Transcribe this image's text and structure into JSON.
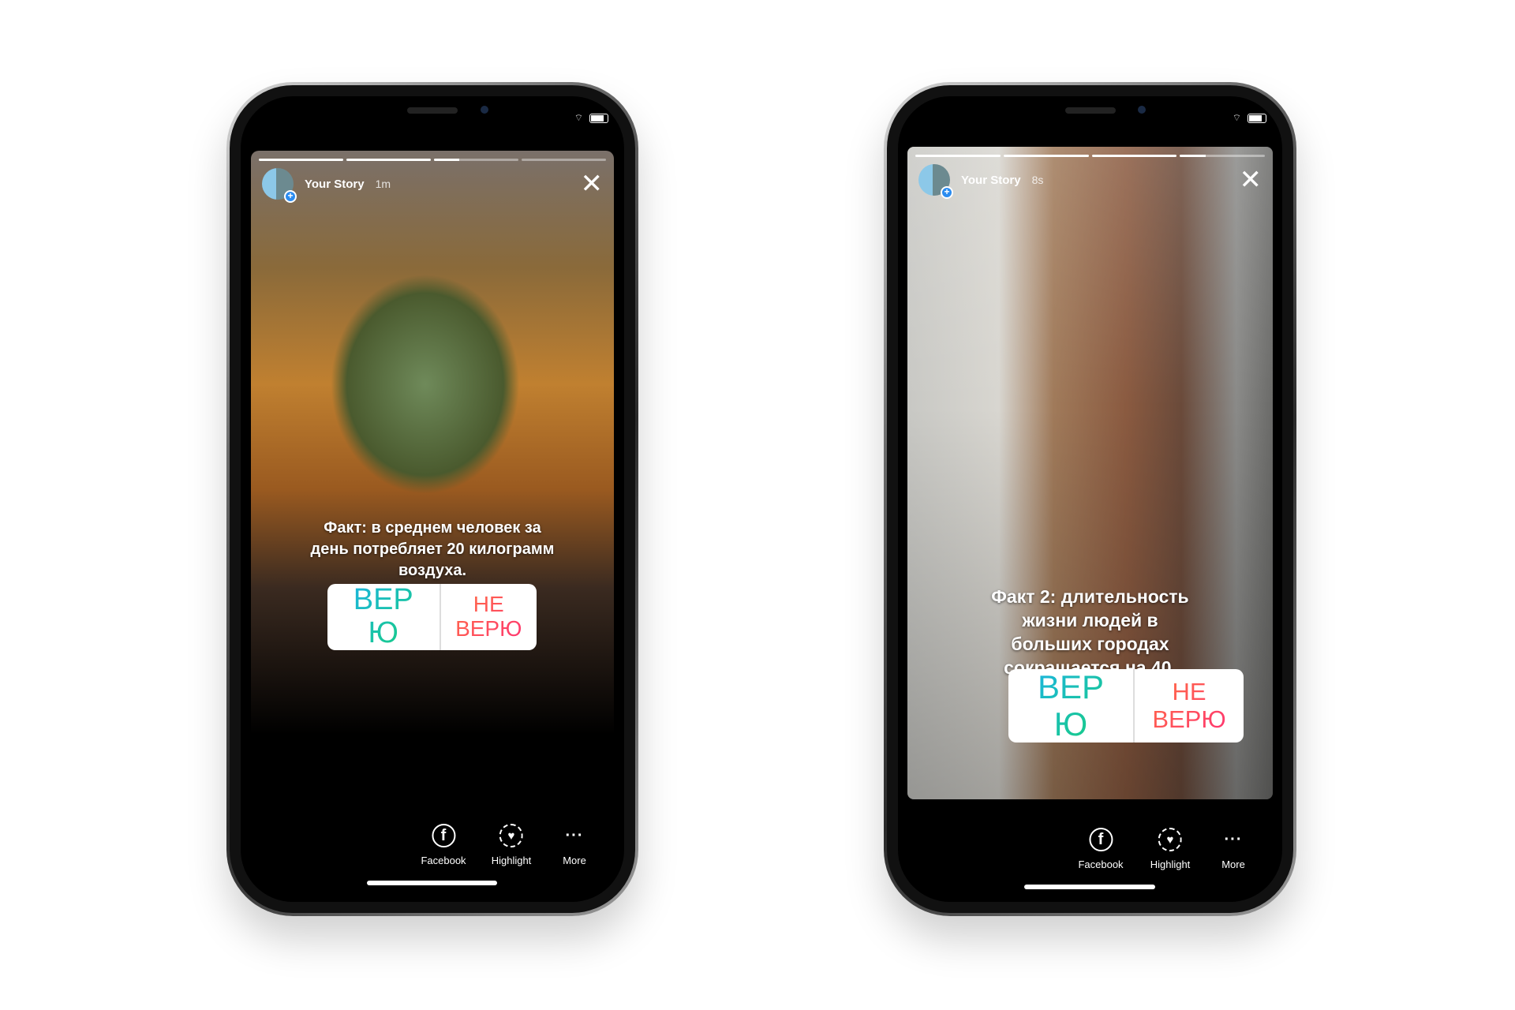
{
  "phones": [
    {
      "story": {
        "title": "Your Story",
        "time": "1m",
        "progress": [
          1,
          1,
          0.3,
          0
        ],
        "caption": "Факт: в среднем человек за день потребляет 20 килограмм воздуха.",
        "poll": {
          "yes": "ВЕР Ю",
          "no": "НЕ ВЕРЮ"
        }
      },
      "actions": [
        {
          "label": "Facebook",
          "icon": "facebook-icon"
        },
        {
          "label": "Highlight",
          "icon": "highlight-heart-icon"
        },
        {
          "label": "More",
          "icon": "more-dots-icon"
        }
      ]
    },
    {
      "story": {
        "title": "Your Story",
        "time": "8s",
        "progress": [
          1,
          1,
          1,
          0.3
        ],
        "caption": "Факт 2: длительность жизни людей в больших городах сокращается на 40.",
        "poll": {
          "yes": "ВЕР Ю",
          "no": "НЕ ВЕРЮ"
        }
      },
      "actions": [
        {
          "label": "Facebook",
          "icon": "facebook-icon"
        },
        {
          "label": "Highlight",
          "icon": "highlight-heart-icon"
        },
        {
          "label": "More",
          "icon": "more-dots-icon"
        }
      ]
    }
  ],
  "icons": {
    "close": "✕",
    "plus": "+",
    "facebook": "f",
    "heart": "♥",
    "more": "···"
  },
  "colors": {
    "poll_yes": [
      "#1cb0f0",
      "#17d36a"
    ],
    "poll_no": [
      "#ff7a3a",
      "#ff2a7a"
    ],
    "badge": "#2b8cf0"
  }
}
